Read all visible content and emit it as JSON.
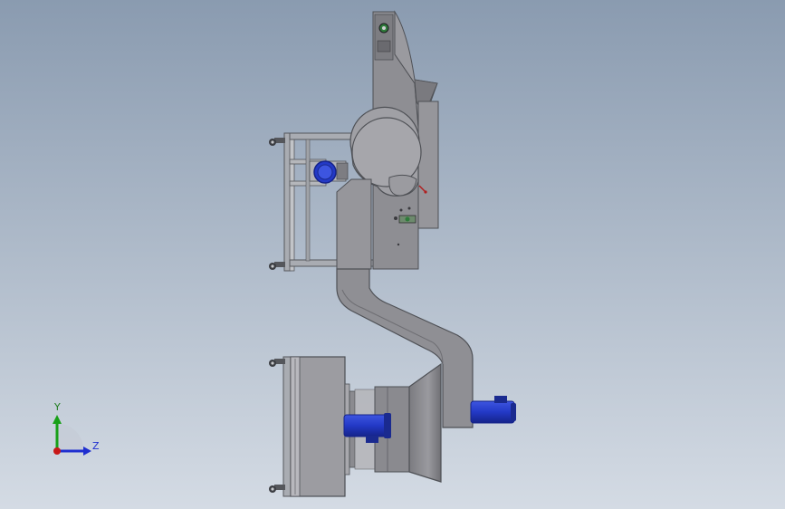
{
  "viewport": {
    "background_top": "#8a9bb0",
    "background_bottom": "#d4dbe4",
    "model_gray": "#8e8e93",
    "model_gray_light": "#b7b7ba",
    "model_gray_dark": "#6f6f74",
    "motor_blue": "#2339c6",
    "motor_blue_dark": "#1a2a8f",
    "frame_gray": "#a9acb2"
  },
  "triad": {
    "y_label": "Y",
    "z_label": "Z",
    "y_color": "#18a018",
    "z_color": "#1f2fd0",
    "x_color": "#c81818"
  },
  "icons": {
    "triad": "coordinate-triad-icon",
    "caster": "caster-wheel-icon",
    "motor": "electric-motor-icon",
    "pressure_gauge": "pressure-gauge-icon"
  }
}
